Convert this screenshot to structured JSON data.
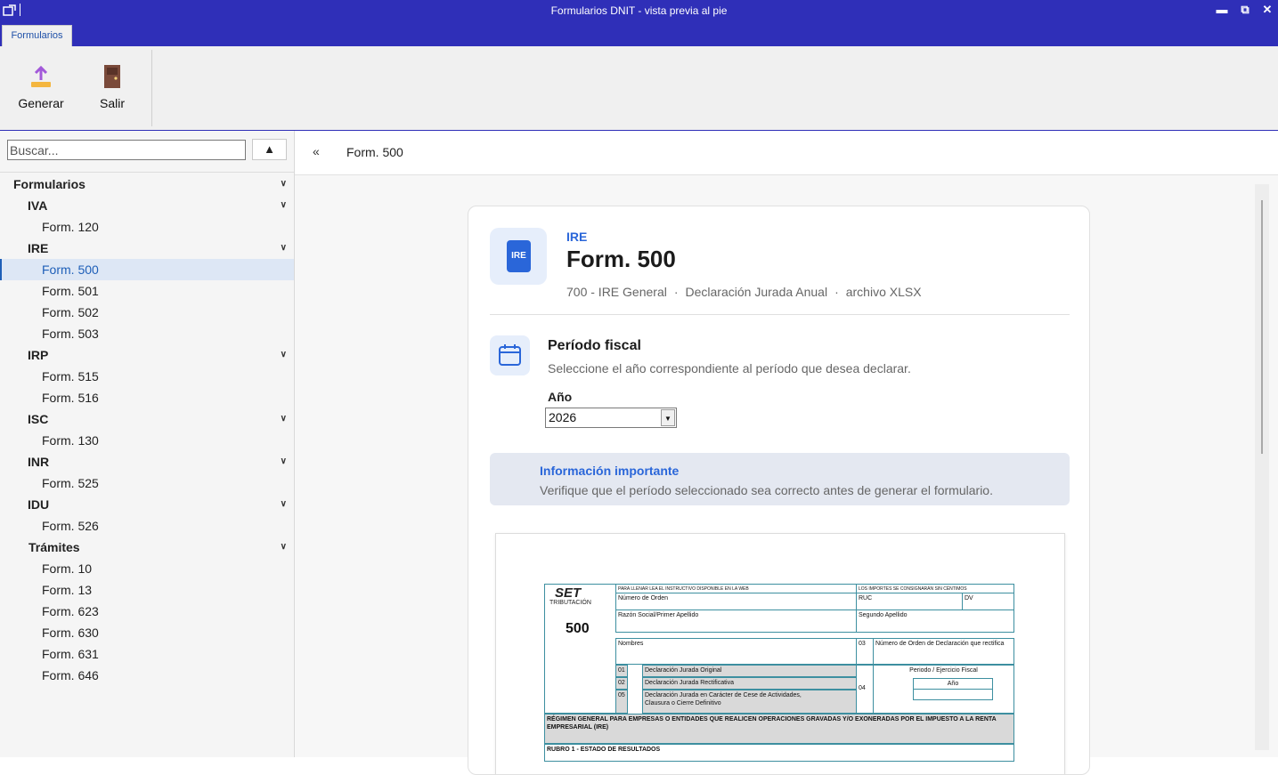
{
  "window": {
    "title": "Formularios DNIT - vista previa al pie",
    "app_icon": "app-icon",
    "controls": {
      "minimize": "▬",
      "restore": "⧉",
      "close": "✕"
    }
  },
  "ribbon": {
    "tab_label": "Formularios",
    "buttons": [
      {
        "label": "Generar",
        "icon": "upload-icon"
      },
      {
        "label": "Salir",
        "icon": "exit-door-icon"
      }
    ]
  },
  "sidebar": {
    "search_placeholder": "Buscar...",
    "collapse_glyph": "▲",
    "tree": {
      "root": "Formularios",
      "groups": [
        {
          "label": "IVA",
          "items": [
            "Form. 120"
          ]
        },
        {
          "label": "IRE",
          "items": [
            "Form. 500",
            "Form. 501",
            "Form. 502",
            "Form. 503"
          ]
        },
        {
          "label": "IRP",
          "items": [
            "Form. 515",
            "Form. 516"
          ]
        },
        {
          "label": "ISC",
          "items": [
            "Form. 130"
          ]
        },
        {
          "label": "INR",
          "items": [
            "Form. 525"
          ]
        },
        {
          "label": "IDU",
          "items": [
            "Form. 526"
          ]
        },
        {
          "label": "Trámites",
          "items": [
            "Form. 10",
            "Form. 13",
            "Form. 623",
            "Form. 630",
            "Form. 631",
            "Form. 646"
          ]
        }
      ],
      "selected": "Form. 500"
    }
  },
  "breadcrumb": {
    "back": "«",
    "current": "Form. 500"
  },
  "form": {
    "badge": "IRE",
    "category": "IRE",
    "title": "Form. 500",
    "meta": [
      "700 - IRE General",
      "Declaración Jurada Anual",
      "archivo XLSX"
    ],
    "meta_separator": "·",
    "period": {
      "title": "Período fiscal",
      "description": "Seleccione el año correspondiente al período que desea declarar.",
      "year_label": "Año",
      "year_value": "2026"
    },
    "info": {
      "title": "Información importante",
      "description": "Verifique que el período seleccionado sea correcto antes de generar el formulario."
    },
    "preview": {
      "logo": "SET",
      "logo_sub": "TRIBUTACIÓN",
      "form_number": "500",
      "header_left": "PARA LLENAR LEA EL INSTRUCTIVO DISPONIBLE EN LA WEB",
      "header_right": "LOS IMPORTES SE CONSIGNARÁN SIN CÉNTIMOS",
      "numero_orden": "Número de Orden",
      "ruc": "RUC",
      "dv": "DV",
      "razon_social": "Razón Social/Primer Apellido",
      "segundo_apellido": "Segundo Apellido",
      "nombres": "Nombres",
      "code_03": "03",
      "numero_orden_rect": "Número de Orden de Declaración que rectifica",
      "rows": [
        {
          "code": "01",
          "label": "Declaración Jurada Original"
        },
        {
          "code": "02",
          "label": "Declaración Jurada Rectificativa"
        },
        {
          "code": "05",
          "label": "Declaración Jurada en Carácter de Cese de Actividades,"
        }
      ],
      "row05_cont": "Clausura o Cierre Definitivo",
      "code_04": "04",
      "periodo": "Periodo / Ejercicio Fiscal",
      "anio": "Año",
      "regimen": "RÉGIMEN GENERAL PARA EMPRESAS O ENTIDADES QUE REALICEN OPERACIONES GRAVADAS Y/O EXONERADAS POR EL IMPUESTO A LA RENTA",
      "regimen_2": "EMPRESARIAL (IRE)",
      "rubro": "RUBRO 1 - ESTADO DE RESULTADOS"
    }
  }
}
